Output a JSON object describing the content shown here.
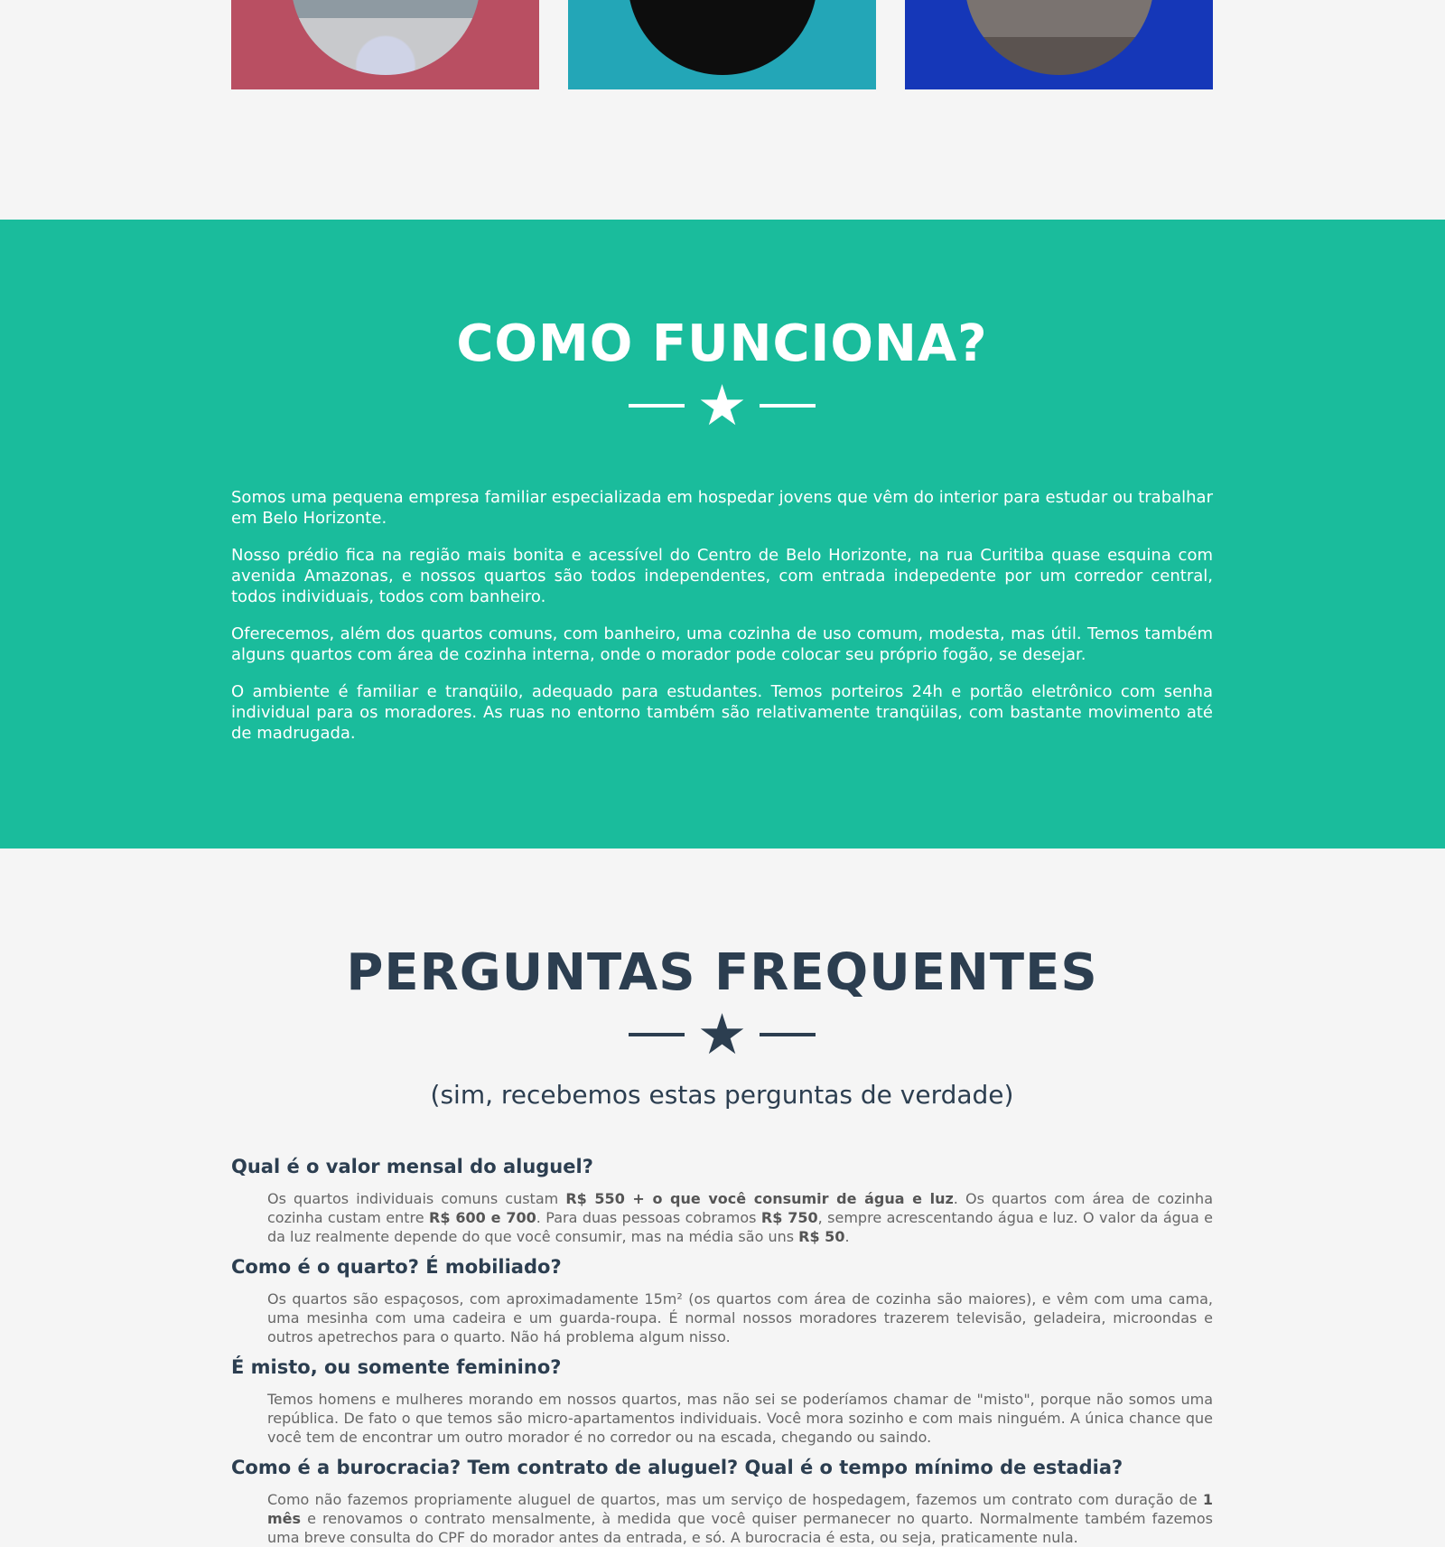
{
  "portfolio": {
    "tiles": [
      {
        "name": "room-bed",
        "color": "#b94f62"
      },
      {
        "name": "stairs",
        "color": "#23a6b7"
      },
      {
        "name": "kitchen",
        "color": "#1537b8"
      }
    ]
  },
  "como": {
    "title": "COMO FUNCIONA?",
    "star": "★",
    "paragraphs": [
      "Somos uma pequena empresa familiar especializada em hospedar jovens que vêm do interior para estudar ou trabalhar em Belo Horizonte.",
      "Nosso prédio fica na região mais bonita e acessível do Centro de Belo Horizonte, na rua Curitiba quase esquina com avenida Amazonas, e nossos quartos são todos independentes, com entrada indepedente por um corredor central, todos individuais, todos com banheiro.",
      "Oferecemos, além dos quartos comuns, com banheiro, uma cozinha de uso comum, modesta, mas útil. Temos também alguns quartos com área de cozinha interna, onde o morador pode colocar seu próprio fogão, se desejar.",
      "O ambiente é familiar e tranqüilo, adequado para estudantes. Temos porteiros 24h e portão eletrônico com senha individual para os moradores. As ruas no entorno também são relativamente tranqüilas, com bastante movimento até de madrugada."
    ]
  },
  "faq": {
    "title": "PERGUNTAS FREQUENTES",
    "star": "★",
    "subtitle": "(sim, recebemos estas perguntas de verdade)",
    "items": [
      {
        "question": "Qual é o valor mensal do aluguel?",
        "answer": [
          {
            "t": "Os quartos individuais comuns custam "
          },
          {
            "t": "R$ 550 + o que você consumir de água e luz",
            "b": true
          },
          {
            "t": ". Os quartos com área de cozinha cozinha custam entre "
          },
          {
            "t": "R$ 600 e 700",
            "b": true
          },
          {
            "t": ". Para duas pessoas cobramos "
          },
          {
            "t": "R$ 750",
            "b": true
          },
          {
            "t": ", sempre acrescentando água e luz. O valor da água e da luz realmente depende do que você consumir, mas na média são uns "
          },
          {
            "t": "R$ 50",
            "b": true
          },
          {
            "t": "."
          }
        ]
      },
      {
        "question": "Como é o quarto? É mobiliado?",
        "answer": [
          {
            "t": "Os quartos são espaçosos, com aproximadamente 15m² (os quartos com área de cozinha são maiores), e vêm com uma cama, uma mesinha com uma cadeira e um guarda-roupa. É normal nossos moradores trazerem televisão, geladeira, microondas e outros apetrechos para o quarto. Não há problema algum nisso."
          }
        ]
      },
      {
        "question": "É misto, ou somente feminino?",
        "answer": [
          {
            "t": "Temos homens e mulheres morando em nossos quartos, mas não sei se poderíamos chamar de \"misto\", porque não somos uma república. De fato o que temos são micro-apartamentos individuais. Você mora sozinho e com mais ninguém. A única chance que você tem de encontrar um outro morador é no corredor ou na escada, chegando ou saindo."
          }
        ]
      },
      {
        "question": "Como é a burocracia? Tem contrato de aluguel? Qual é o tempo mínimo de estadia?",
        "answer": [
          {
            "t": "Como não fazemos propriamente aluguel de quartos, mas um serviço de hospedagem, fazemos um contrato com duração de "
          },
          {
            "t": "1 mês",
            "b": true
          },
          {
            "t": " e renovamos o contrato mensalmente, à medida que você quiser permanecer no quarto. Normalmente também fazemos uma breve consulta do CPF do morador antes da entrada, e só. A burocracia é esta, ou seja, praticamente nula."
          }
        ]
      }
    ]
  }
}
